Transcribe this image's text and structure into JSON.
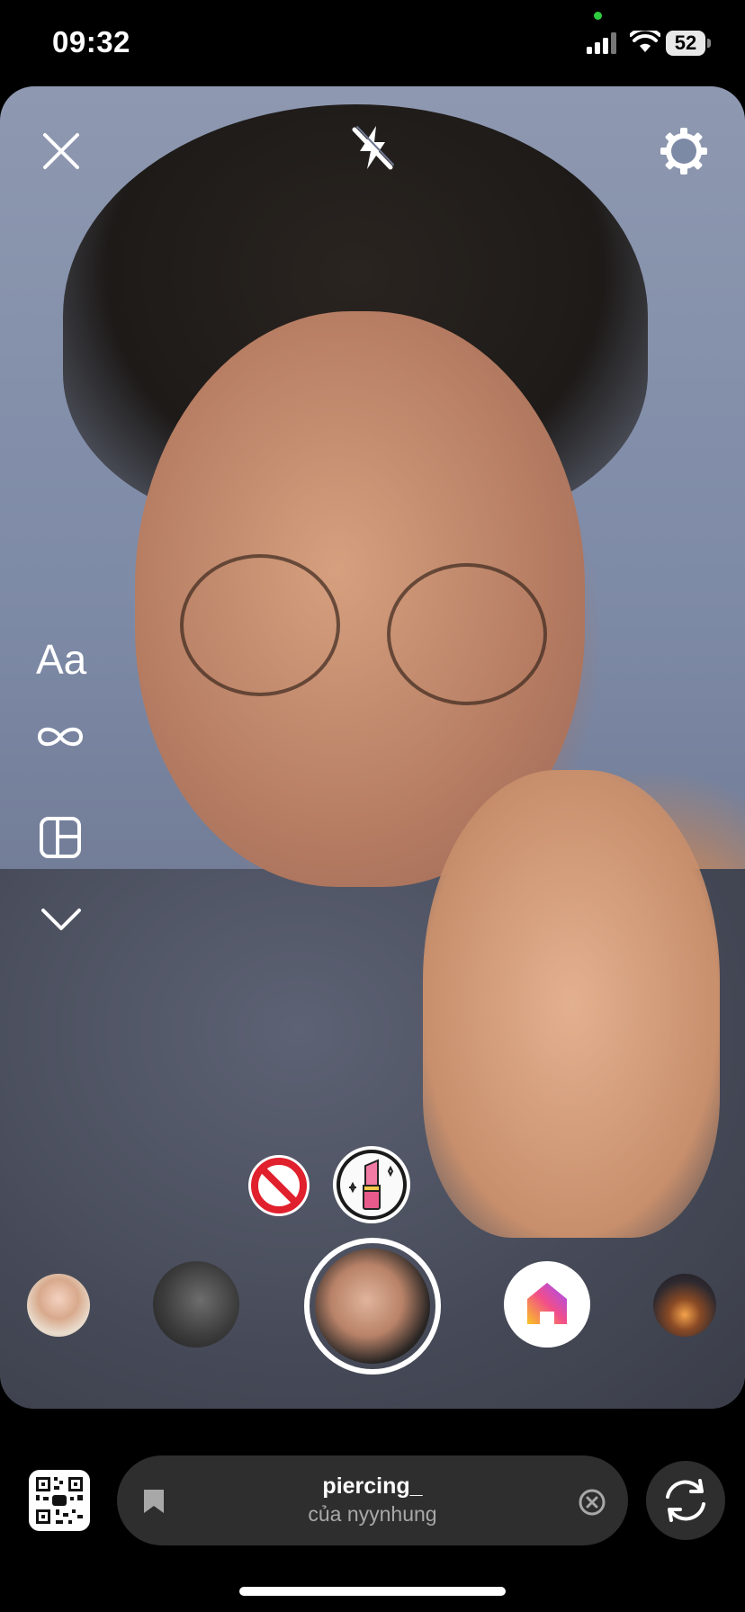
{
  "status_bar": {
    "time": "09:32",
    "battery": "52",
    "icons": [
      "signal-icon",
      "wifi-icon",
      "battery-icon"
    ]
  },
  "camera": {
    "top_controls": [
      "close-icon",
      "flash-off-icon",
      "settings-icon"
    ],
    "left_tools": {
      "text_label": "Aa",
      "icons": [
        "boomerang-icon",
        "layout-icon",
        "chevron-down-icon"
      ]
    },
    "effect_tray": {
      "items": [
        "no-effect-icon",
        "lipstick-icon"
      ]
    },
    "filters": [
      {
        "name": "filter-portrait-blonde"
      },
      {
        "name": "filter-dark-mood"
      },
      {
        "name": "filter-selected-piercing"
      },
      {
        "name": "filter-home"
      },
      {
        "name": "filter-sunset-sea"
      }
    ]
  },
  "bottom_bar": {
    "effect_name": "piercing_",
    "effect_author": "của nyynhung",
    "icons": [
      "qr-code-icon",
      "bookmark-icon",
      "clear-icon",
      "flip-camera-icon"
    ]
  },
  "colors": {
    "background": "#000000",
    "pill": "#2e2e2e",
    "muted_text": "#a8a8a8",
    "accent_red": "#e0202c"
  }
}
